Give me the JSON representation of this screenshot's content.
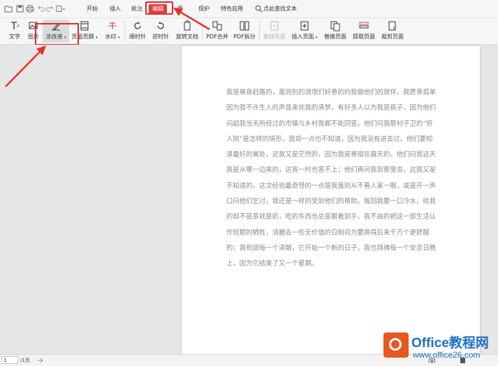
{
  "menubar": {
    "items": [
      "开始",
      "插入",
      "批注",
      "编辑",
      "页",
      "保护",
      "特色应用"
    ],
    "active": "编辑",
    "search_label": "点此查找文本"
  },
  "toolbar": {
    "items": [
      "文字",
      "图片",
      "涂改液",
      "页眉页脚",
      "水印",
      "顺时针",
      "逆时针",
      "旋转文档",
      "PDF合并",
      "PDF拆分",
      "删除页面",
      "插入页面",
      "替换页面",
      "提取页面",
      "裁剪页面"
    ]
  },
  "document": {
    "paragraph": "我是单身赶路的，虽则别的流氓们好意的约我做他们的旅伴，我愿意孤单因为我不许生人的声音来扰我的清梦。有好多人以为我是疯子，因为他们问起我当天所经过的市镇与乡村我都不能回答。他们问我那村子卫的“穷人院”是怎样的情形，我却一点也不知道，因为我没有进去过。他们要知道最好的寓处，这我又是茫然的，因为我是寄宿在露天的。他们问我这天我是从哪一边来的，这我一时也答不上；他们再问我到那里去，这我又是不知道的。这次经验最奇怪的一点是我虽则从不看人家一眼，或是开一声口问他们乞讨，我还是一样的受到他们的帮助。每回我要一口冷水，给我的却不是茶就是奶，吃的东西也总是跟着到手。我不由的把这一部生活认作短期的牺牲，消磨去一些无价值的日制司为要换得后来千万个更舒服的；我祝颂每一个清朝，它开始一个新的日子，我也拜祷每一个安息日晚上，因为它结束了又一个星期。"
  },
  "statusbar": {
    "page_current": "1",
    "page_total": "/1页"
  },
  "watermark": {
    "title": "Office教程网",
    "url": "www.office26.com"
  },
  "colors": {
    "highlight": "#e02b2b",
    "active_tab": "#e0403f",
    "logo_orange": "#e8581f",
    "logo_blue": "#1e6fc9"
  }
}
